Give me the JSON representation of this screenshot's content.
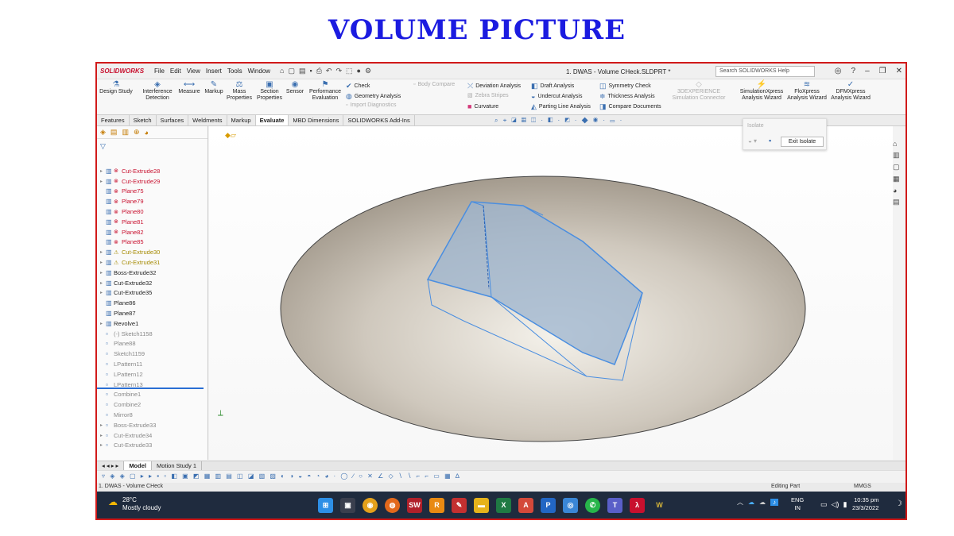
{
  "heading": "VOLUME PICTURE",
  "app": {
    "logo": "SOLIDWORKS",
    "menus": [
      "File",
      "Edit",
      "View",
      "Insert",
      "Tools",
      "Window"
    ],
    "doc_title": "1. DWAS - Volume CHeck.SLDPRT *",
    "search_placeholder": "Search SOLIDWORKS Help"
  },
  "ribbon": {
    "design_study": "Design Study",
    "interference": "Interference Detection",
    "measure": "Measure",
    "markup": "Markup",
    "mass": "Mass Properties",
    "section": "Section Properties",
    "sensor": "Sensor",
    "performance": "Performance Evaluation",
    "check": "Check",
    "geometry_analysis": "Geometry Analysis",
    "import_diagnostics": "Import Diagnostics",
    "body_compare": "Body Compare",
    "deviation": "Deviation Analysis",
    "zebra": "Zebra Stripes",
    "curvature": "Curvature",
    "draft": "Draft Analysis",
    "undercut": "Undercut Analysis",
    "parting": "Parting Line Analysis",
    "symmetry": "Symmetry Check",
    "thickness": "Thickness Analysis",
    "compare_docs": "Compare Documents",
    "experience": "3DEXPERIENCE Simulation Connector",
    "simxpress": "SimulationXpress Analysis Wizard",
    "floxpress": "FloXpress Analysis Wizard",
    "dfmxpress": "DFMXpress Analysis Wizard"
  },
  "tabs": [
    "Features",
    "Sketch",
    "Surfaces",
    "Weldments",
    "Markup",
    "Evaluate",
    "MBD Dimensions",
    "SOLIDWORKS Add-Ins"
  ],
  "tree": [
    {
      "label": "Cut-Extrude28",
      "kind": "red",
      "expand": true
    },
    {
      "label": "Cut-Extrude29",
      "kind": "red",
      "expand": true
    },
    {
      "label": "Plane75",
      "kind": "red"
    },
    {
      "label": "Plane79",
      "kind": "red"
    },
    {
      "label": "Plane80",
      "kind": "red"
    },
    {
      "label": "Plane81",
      "kind": "red"
    },
    {
      "label": "Plane82",
      "kind": "red"
    },
    {
      "label": "Plane85",
      "kind": "red"
    },
    {
      "label": "Cut-Extrude30",
      "kind": "yel",
      "expand": true
    },
    {
      "label": "Cut-Extrude31",
      "kind": "yel",
      "expand": true
    },
    {
      "label": "Boss-Extrude32",
      "kind": "ok",
      "expand": true
    },
    {
      "label": "Cut-Extrude32",
      "kind": "ok",
      "expand": true
    },
    {
      "label": "Cut-Extrude35",
      "kind": "ok",
      "expand": true
    },
    {
      "label": "Plane86",
      "kind": "ok"
    },
    {
      "label": "Plane87",
      "kind": "ok"
    },
    {
      "label": "Revolve1",
      "kind": "ok",
      "expand": true
    },
    {
      "label": "(-) Sketch1158",
      "kind": "dim"
    },
    {
      "label": "Plane88",
      "kind": "dim"
    },
    {
      "label": "Sketch1159",
      "kind": "dim"
    },
    {
      "label": "LPattern11",
      "kind": "dim"
    },
    {
      "label": "LPattern12",
      "kind": "dim"
    },
    {
      "label": "LPattern13",
      "kind": "dim"
    },
    {
      "label": "Combine1",
      "kind": "dim"
    },
    {
      "label": "Combine2",
      "kind": "dim"
    },
    {
      "label": "Mirror8",
      "kind": "dim"
    },
    {
      "label": "Boss-Extrude33",
      "kind": "dim",
      "expand": true
    },
    {
      "label": "Cut-Extrude34",
      "kind": "dim",
      "expand": true
    },
    {
      "label": "Cut-Extrude33",
      "kind": "dim",
      "expand": true
    }
  ],
  "isolate": {
    "title": "Isolate",
    "exit": "Exit Isolate"
  },
  "bottom_tabs": [
    "Model",
    "Motion Study 1"
  ],
  "status": {
    "doc": "1. DWAS - Volume CHeck",
    "mode": "Editing Part",
    "units": "MMGS"
  },
  "taskbar": {
    "temp": "28°C",
    "weather": "Mostly cloudy",
    "lang1": "ENG",
    "lang2": "IN",
    "time": "10:35 pm",
    "date": "23/3/2022"
  }
}
